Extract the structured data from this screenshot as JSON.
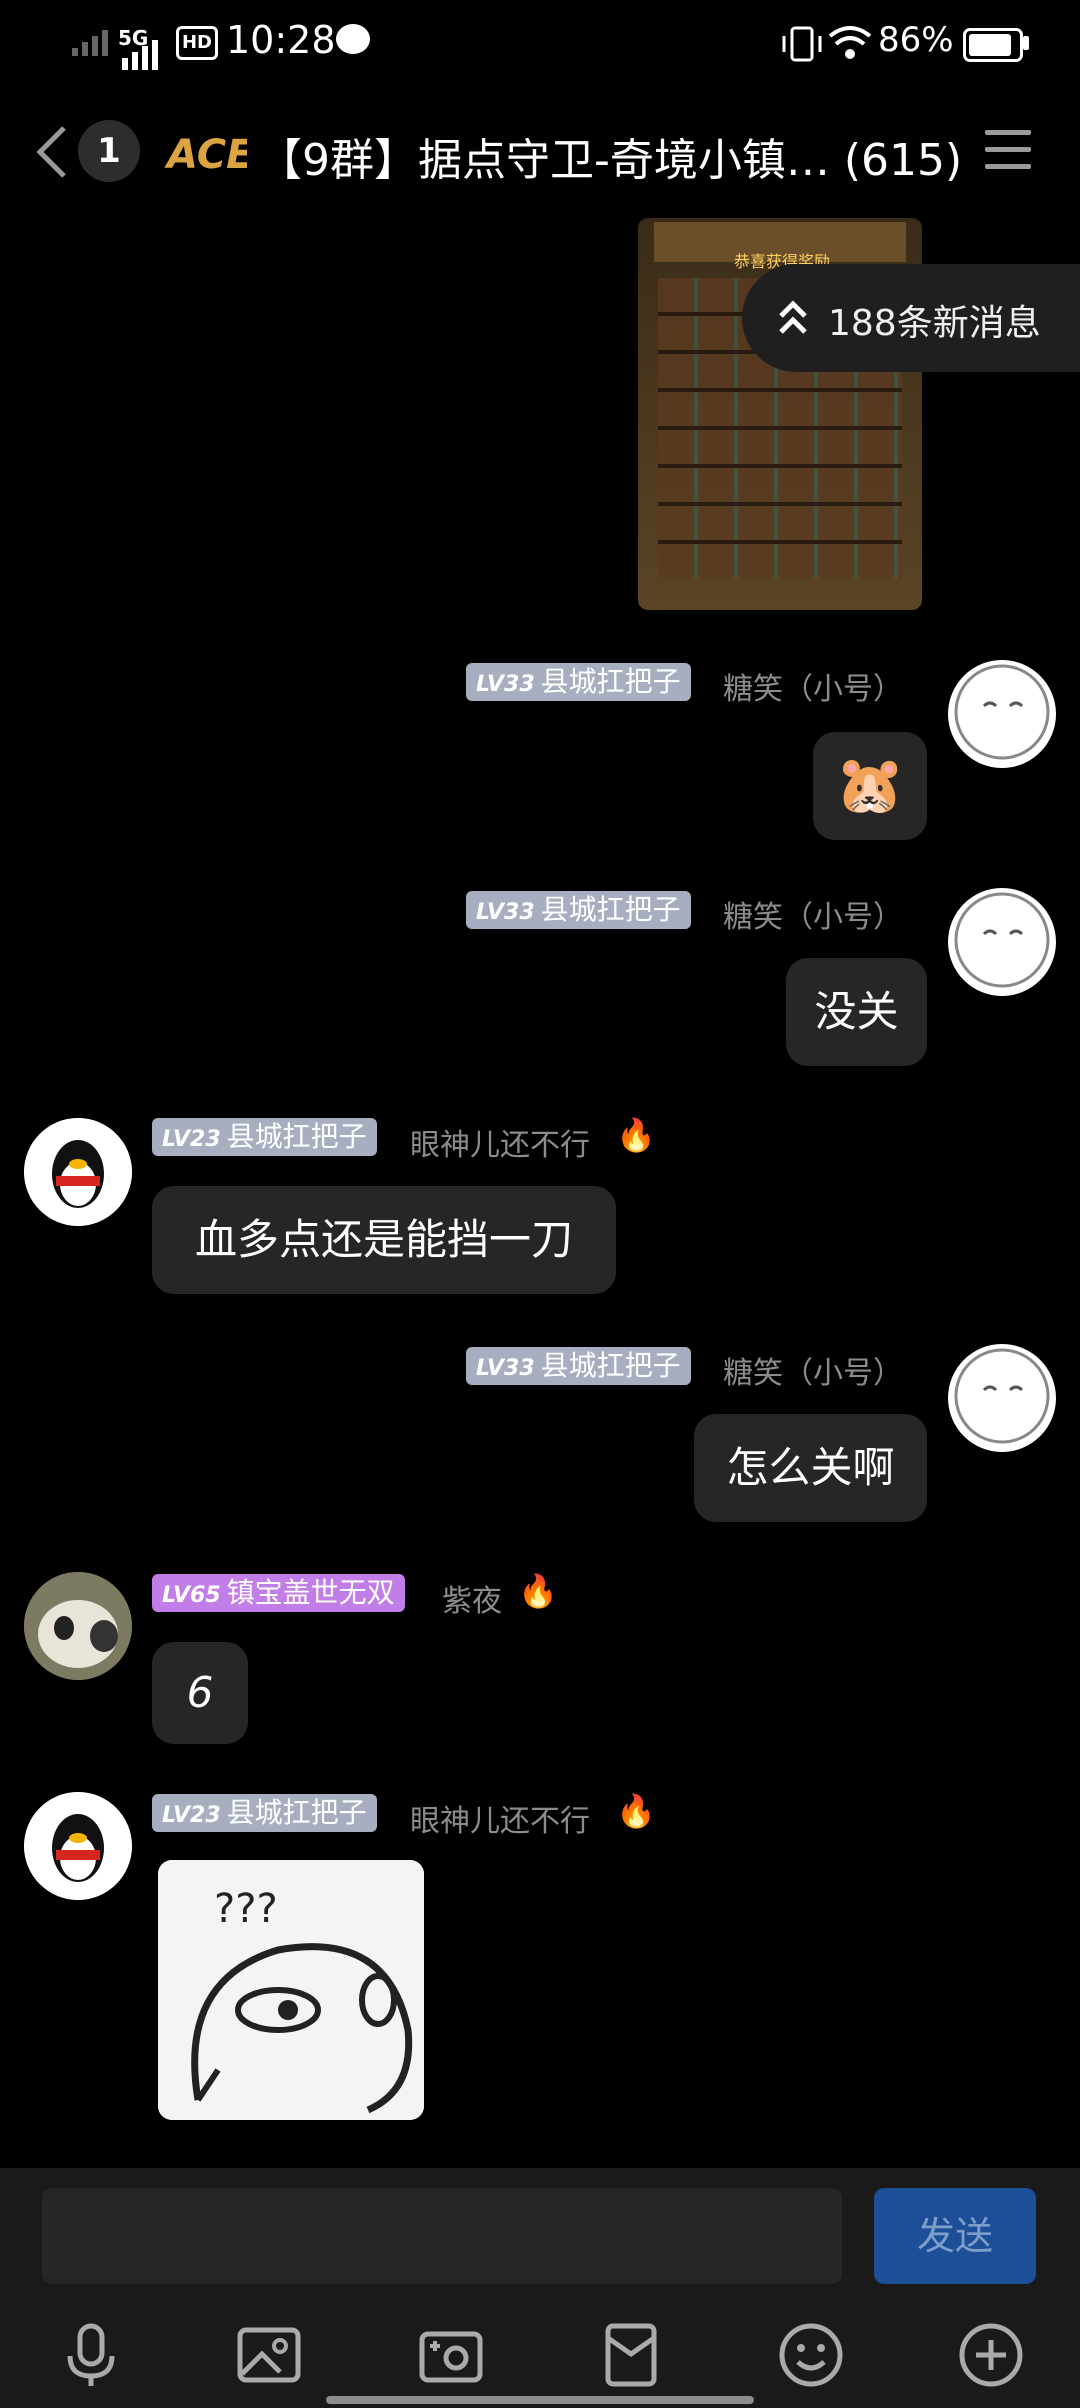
{
  "status_bar": {
    "network": "5G",
    "hd": "HD",
    "time": "10:28",
    "battery": "86%"
  },
  "header": {
    "unread_count": "1",
    "logo_text": "ACE",
    "title": "【9群】据点守卫-奇境小镇… (615)"
  },
  "new_messages": "188条新消息",
  "pinned_image": {
    "caption": "恭喜获得奖励"
  },
  "messages": [
    {
      "side": "right",
      "level": "LV33",
      "title": "县城扛把子",
      "nick": "糖笑（小号）",
      "content": "🐹"
    },
    {
      "side": "right",
      "level": "LV33",
      "title": "县城扛把子",
      "nick": "糖笑（小号）",
      "content": "没关"
    },
    {
      "side": "left",
      "level": "LV23",
      "title": "县城扛把子",
      "nick": "眼神儿还不行",
      "content": "血多点还是能挡一刀"
    },
    {
      "side": "right",
      "level": "LV33",
      "title": "县城扛把子",
      "nick": "糖笑（小号）",
      "content": "怎么关啊"
    },
    {
      "side": "left",
      "level": "LV65",
      "title": "镇宝盖世无双",
      "nick": "紫夜",
      "content": "6"
    },
    {
      "side": "left",
      "level": "LV23",
      "title": "县城扛把子",
      "nick": "眼神儿还不行",
      "content": "???"
    }
  ],
  "input": {
    "placeholder": "",
    "send_label": "发送"
  },
  "toolbar": [
    "mic-icon",
    "image-icon",
    "camera-icon",
    "red-packet-icon",
    "emoji-icon",
    "plus-icon"
  ]
}
